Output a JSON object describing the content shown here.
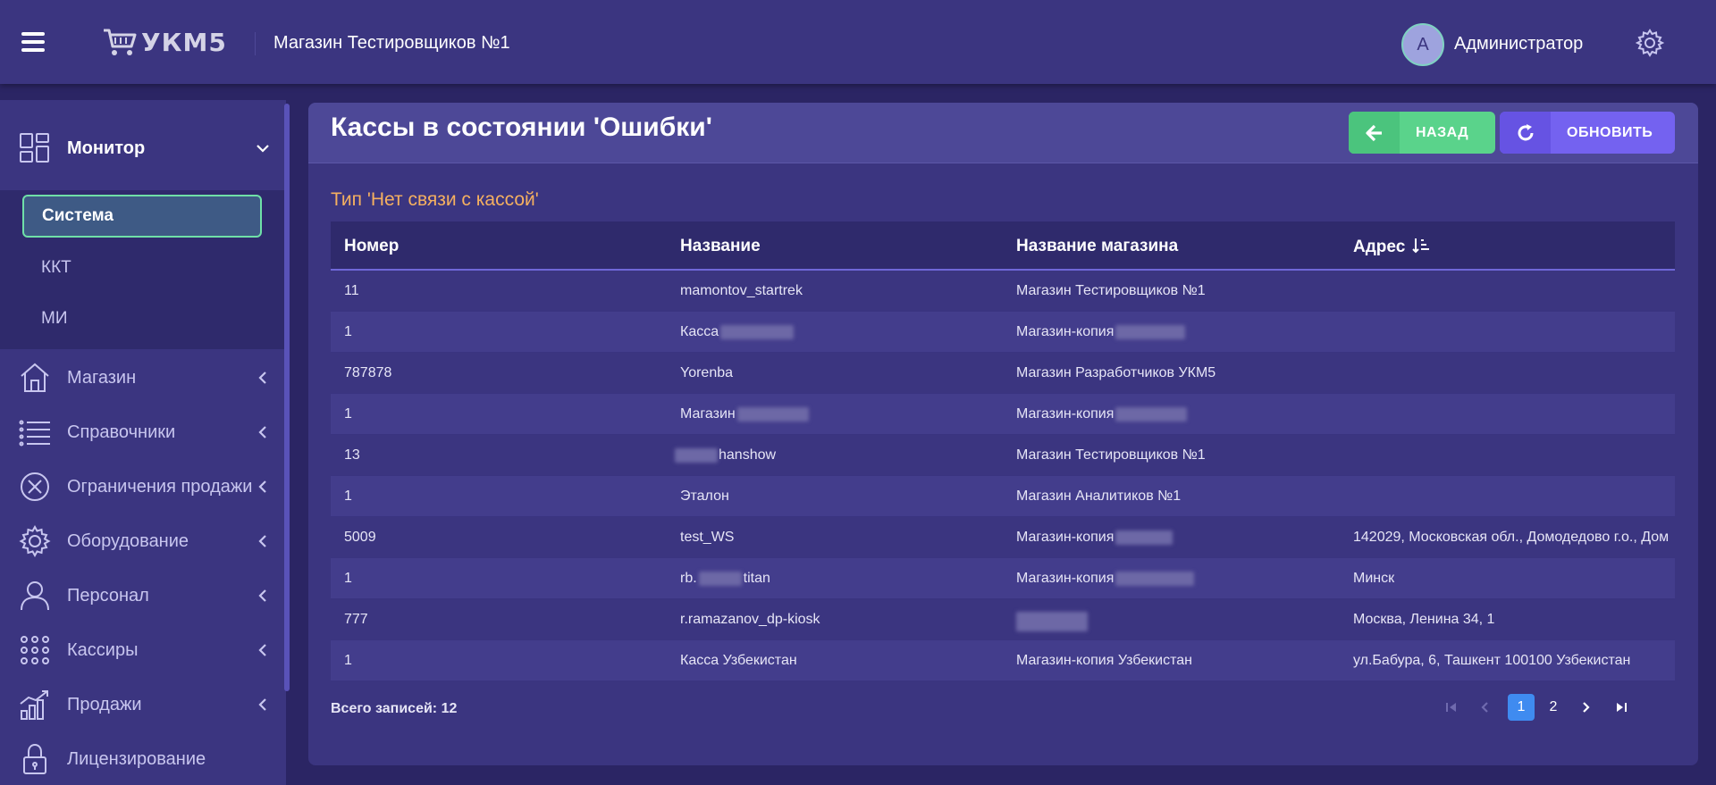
{
  "header": {
    "logo_text": "УКМ5",
    "store_name": "Магазин Тестировщиков №1",
    "avatar_letter": "A",
    "user_name": "Администратор"
  },
  "sidebar": {
    "monitor_label": "Монитор",
    "submenu": [
      {
        "label": "Система",
        "active": true
      },
      {
        "label": "ККТ",
        "active": false
      },
      {
        "label": "МИ",
        "active": false
      }
    ],
    "items": [
      {
        "label": "Магазин",
        "icon": "house-icon"
      },
      {
        "label": "Справочники",
        "icon": "list-icon"
      },
      {
        "label": "Ограничения продажи",
        "icon": "x-circle-icon"
      },
      {
        "label": "Оборудование",
        "icon": "gear-icon"
      },
      {
        "label": "Персонал",
        "icon": "person-icon"
      },
      {
        "label": "Кассиры",
        "icon": "dots-grid-icon"
      },
      {
        "label": "Продажи",
        "icon": "bar-chart-icon"
      },
      {
        "label": "Лицензирование",
        "icon": "lock-icon"
      }
    ]
  },
  "panel": {
    "title": "Кассы в состоянии 'Ошибки'",
    "back_label": "НАЗАД",
    "refresh_label": "ОБНОВИТЬ",
    "type_label": "Тип 'Нет связи с кассой'"
  },
  "table": {
    "columns": [
      "Номер",
      "Название",
      "Название магазина",
      "Адрес"
    ],
    "rows": [
      {
        "number": "11",
        "name": "mamontov_startrek",
        "store": "Магазин Тестировщиков №1",
        "address": ""
      },
      {
        "number": "1",
        "name": "Касса",
        "store": "Магазин-копия",
        "address": ""
      },
      {
        "number": "787878",
        "name": "Yorenba",
        "store": "Магазин Разработчиков УКМ5",
        "address": ""
      },
      {
        "number": "1",
        "name": "Магазин",
        "store": "Магазин-копия",
        "address": ""
      },
      {
        "number": "13",
        "name": "hanshow",
        "store": "Магазин Тестировщиков №1",
        "address": ""
      },
      {
        "number": "1",
        "name": "Эталон",
        "store": "Магазин Аналитиков №1",
        "address": ""
      },
      {
        "number": "5009",
        "name": "test_WS",
        "store": "Магазин-копия",
        "address": "142029, Московская обл., Домодедово г.о., Дом"
      },
      {
        "number": "1",
        "name": "rb.",
        "name_suffix": "titan",
        "store": "Магазин-копия",
        "address": "Минск"
      },
      {
        "number": "777",
        "name": "r.ramazanov_dp-kiosk",
        "store": "",
        "address": "Москва, Ленина 34, 1"
      },
      {
        "number": "1",
        "name": "Касса Узбекистан",
        "store": "Магазин-копия Узбекистан",
        "address": "ул.Бабура, 6, Ташкент 100100 Узбекистан"
      }
    ],
    "total_label": "Всего записей: 12"
  },
  "pagination": {
    "pages": [
      "1",
      "2"
    ],
    "current_page": "1"
  },
  "colors": {
    "accent_green": "#5ad38b",
    "accent_purple": "#7462f0",
    "type_orange": "#f5b060",
    "page_active": "#3f8bf0"
  }
}
